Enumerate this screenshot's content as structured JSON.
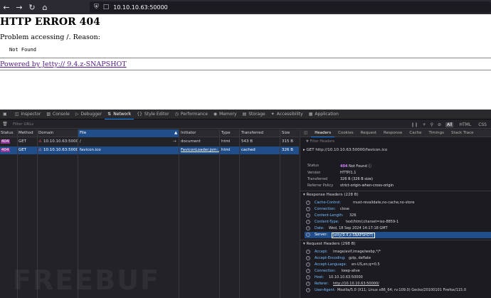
{
  "browser": {
    "url": "10.10.10.63:50000"
  },
  "page": {
    "heading": "HTTP ERROR 404",
    "reason": "Problem accessing /. Reason:",
    "message": "Not Found",
    "powered_by": "Powered by Jetty:// 9.4.z-SNAPSHOT"
  },
  "devtools": {
    "tabs": [
      {
        "label": "Inspector",
        "icon": "inspector-icon"
      },
      {
        "label": "Console",
        "icon": "console-icon"
      },
      {
        "label": "Debugger",
        "icon": "debugger-icon"
      },
      {
        "label": "Network",
        "icon": "network-icon"
      },
      {
        "label": "Style Editor",
        "icon": "style-editor-icon"
      },
      {
        "label": "Performance",
        "icon": "performance-icon"
      },
      {
        "label": "Memory",
        "icon": "memory-icon"
      },
      {
        "label": "Storage",
        "icon": "storage-icon"
      },
      {
        "label": "Accessibility",
        "icon": "accessibility-icon"
      },
      {
        "label": "Application",
        "icon": "application-icon"
      }
    ],
    "filter_placeholder": "Filter URLs",
    "type_filters": [
      "All",
      "HTML",
      "CSS"
    ],
    "columns": [
      "Status",
      "Method",
      "Domain",
      "File",
      "Initiator",
      "Type",
      "Transferred",
      "Size"
    ],
    "requests": [
      {
        "status": "404",
        "method": "GET",
        "domain": "10.10.10.63:5000...",
        "file": "/",
        "initiator": "document",
        "type": "html",
        "transferred": "543 B",
        "size": "315 B",
        "selected": false
      },
      {
        "status": "404",
        "method": "GET",
        "domain": "10.10.10.63:5000...",
        "file": "favicon.ico",
        "initiator": "FaviconLoader.jsm:...",
        "type": "html",
        "transferred": "cached",
        "size": "326 B",
        "selected": true
      }
    ],
    "detail_tabs": [
      "Headers",
      "Cookies",
      "Request",
      "Response",
      "Cache",
      "Timings",
      "Stack Trace"
    ],
    "filter_headers": "Filter Headers",
    "request_line": "GET  http://10.10.10.63:50000/favicon.ico",
    "summary": {
      "status_label": "Status",
      "status_code": "404",
      "status_text": "Not Found",
      "version_label": "Version",
      "version": "HTTP/1.1",
      "transferred_label": "Transferred",
      "transferred": "326 B (326 B size)",
      "referrer_label": "Referrer Policy",
      "referrer": "strict-origin-when-cross-origin"
    },
    "response_headers_title": "Response Headers (228 B)",
    "response_headers": [
      {
        "name": "Cache-Control:",
        "value": "must-revalidate,no-cache,no-store"
      },
      {
        "name": "Connection:",
        "value": "close"
      },
      {
        "name": "Content-Length:",
        "value": "326"
      },
      {
        "name": "Content-Type:",
        "value": "text/html;charset=iso-8859-1"
      },
      {
        "name": "Date:",
        "value": "Wed, 18 Sep 2024 14:17:18 GMT"
      },
      {
        "name": "Server:",
        "value": "Jetty(9.4.z-SNAPSHOT)"
      }
    ],
    "request_headers_title": "Request Headers (298 B)",
    "request_headers": [
      {
        "name": "Accept:",
        "value": "image/avif,image/webp,*/*"
      },
      {
        "name": "Accept-Encoding:",
        "value": "gzip, deflate"
      },
      {
        "name": "Accept-Language:",
        "value": "en-US,en;q=0.5"
      },
      {
        "name": "Connection:",
        "value": "keep-alive"
      },
      {
        "name": "Host:",
        "value": "10.10.10.63:50000"
      },
      {
        "name": "Referer:",
        "value": "http://10.10.10.63:50000/"
      },
      {
        "name": "User-Agent:",
        "value": "Mozilla/5.0 (X11; Linux x86_64; rv:109.0) Gecko/20100101 Firefox/115.0"
      }
    ]
  },
  "watermark": "FREEBUF"
}
